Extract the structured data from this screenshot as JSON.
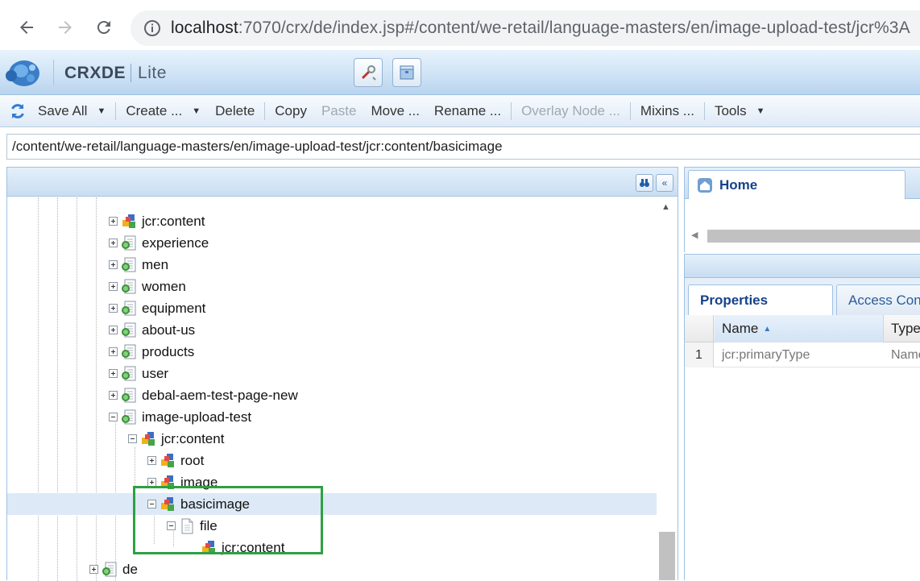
{
  "browser": {
    "url_host": "localhost",
    "url_rest": ":7070/crx/de/index.jsp#/content/we-retail/language-masters/en/image-upload-test/jcr%3A",
    "back_icon": "arrow-left-icon",
    "forward_icon": "arrow-right-icon",
    "reload_icon": "reload-icon",
    "info_icon": "info-icon"
  },
  "app": {
    "name": "CRXDE",
    "edition": "Lite"
  },
  "toolbar": {
    "save_all": "Save All",
    "create": "Create ...",
    "delete": "Delete",
    "copy": "Copy",
    "paste": "Paste",
    "move": "Move ...",
    "rename": "Rename ...",
    "overlay_node": "Overlay Node ...",
    "mixins": "Mixins ...",
    "tools": "Tools"
  },
  "path": "/content/we-retail/language-masters/en/image-upload-test/jcr:content/basicimage",
  "tree": {
    "nodes": [
      {
        "label": "jcr:content",
        "type": "component",
        "expander": "plus"
      },
      {
        "label": "experience",
        "type": "page",
        "expander": "plus"
      },
      {
        "label": "men",
        "type": "page",
        "expander": "plus"
      },
      {
        "label": "women",
        "type": "page",
        "expander": "plus"
      },
      {
        "label": "equipment",
        "type": "page",
        "expander": "plus"
      },
      {
        "label": "about-us",
        "type": "page",
        "expander": "plus"
      },
      {
        "label": "products",
        "type": "page",
        "expander": "plus"
      },
      {
        "label": "user",
        "type": "page",
        "expander": "plus"
      },
      {
        "label": "debal-aem-test-page-new",
        "type": "page",
        "expander": "plus"
      },
      {
        "label": "image-upload-test",
        "type": "page",
        "expander": "minus"
      },
      {
        "label": "jcr:content",
        "type": "component",
        "expander": "minus"
      },
      {
        "label": "root",
        "type": "component",
        "expander": "plus"
      },
      {
        "label": "image",
        "type": "component",
        "expander": "plus"
      },
      {
        "label": "basicimage",
        "type": "component",
        "expander": "minus",
        "selected": true
      },
      {
        "label": "file",
        "type": "file",
        "expander": "minus"
      },
      {
        "label": "jcr:content",
        "type": "component",
        "expander": "none"
      },
      {
        "label": "de",
        "type": "page",
        "expander": "plus"
      }
    ]
  },
  "home_tab": "Home",
  "properties": {
    "tabs": [
      "Properties",
      "Access Contr"
    ],
    "columns": {
      "name": "Name",
      "type": "Type"
    },
    "rows": [
      {
        "num": "1",
        "name": "jcr:primaryType",
        "type": "Name"
      }
    ]
  },
  "colors": {
    "highlight_box": "#2ea043",
    "tab_text": "#15428b",
    "selected_row": "#dde9f6"
  }
}
